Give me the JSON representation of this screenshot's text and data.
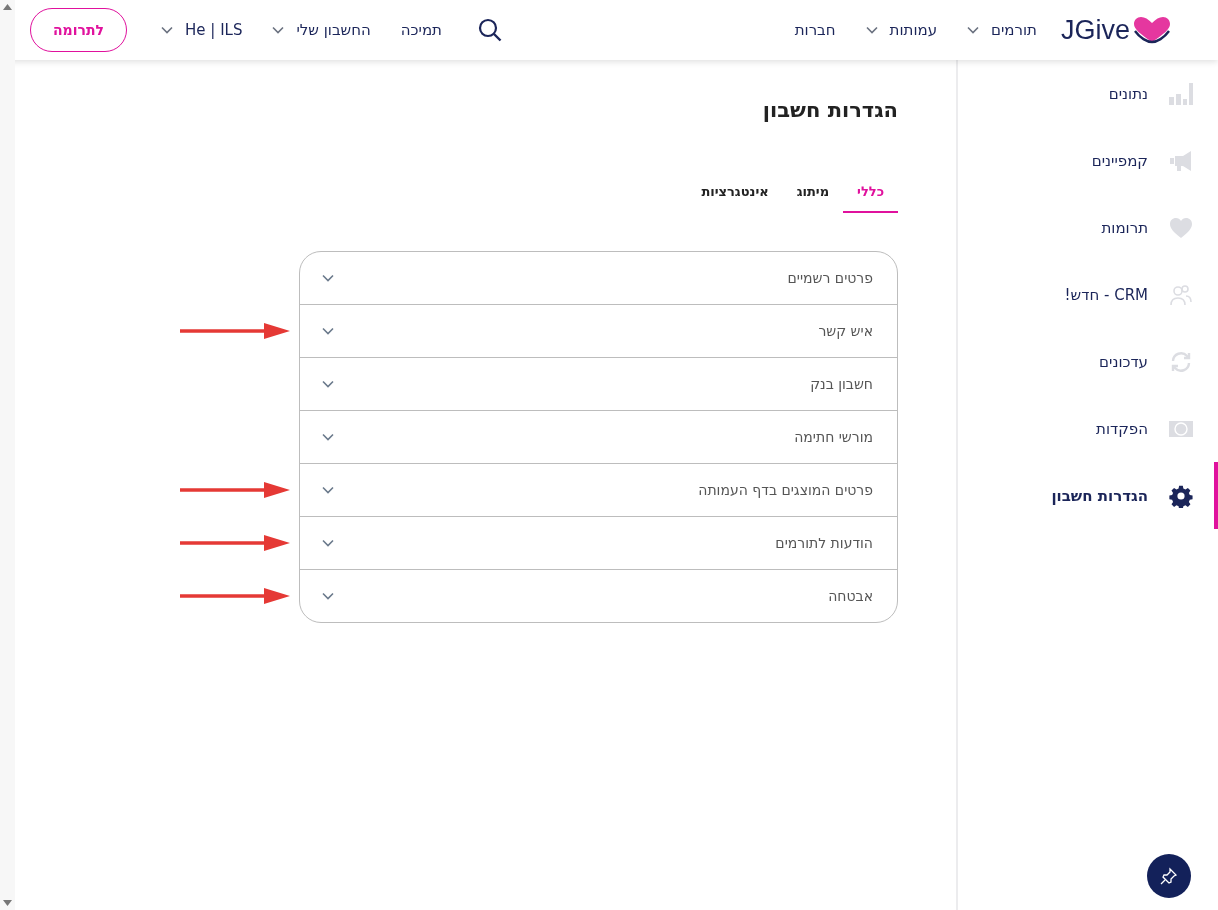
{
  "header": {
    "logo": "JGive",
    "nav": [
      {
        "label": "תורמים",
        "dropdown": true
      },
      {
        "label": "עמותות",
        "dropdown": true
      },
      {
        "label": "חברות",
        "dropdown": false
      }
    ],
    "user_nav": [
      {
        "label": "תמיכה",
        "dropdown": false
      },
      {
        "label": "החשבון שלי",
        "dropdown": true
      },
      {
        "label": "He | ILS",
        "dropdown": true
      }
    ],
    "donate_button": "לתרומה"
  },
  "sidebar": {
    "items": [
      {
        "label": "נתונים",
        "kind": "chart",
        "selected": false
      },
      {
        "label": "קמפיינים",
        "kind": "megaphone",
        "selected": false
      },
      {
        "label": "תרומות",
        "kind": "heart",
        "selected": false
      },
      {
        "label": "CRM - חדש!",
        "kind": "people",
        "selected": false
      },
      {
        "label": "עדכונים",
        "kind": "refresh",
        "selected": false
      },
      {
        "label": "הפקדות",
        "kind": "cash",
        "selected": false
      },
      {
        "label": "הגדרות חשבון",
        "kind": "gear",
        "selected": true
      }
    ]
  },
  "page": {
    "title": "הגדרות חשבון",
    "tabs": [
      {
        "label": "כללי",
        "selected": true
      },
      {
        "label": "מיתוג",
        "selected": false
      },
      {
        "label": "אינטגרציות",
        "selected": false
      }
    ],
    "sections": [
      {
        "label": "פרטים רשמיים",
        "expanded": false,
        "marked": false
      },
      {
        "label": "איש קשר",
        "expanded": false,
        "marked": true
      },
      {
        "label": "חשבון בנק",
        "expanded": false,
        "marked": false
      },
      {
        "label": "מורשי חתימה",
        "expanded": false,
        "marked": false
      },
      {
        "label": "פרטים המוצגים בדף העמותה",
        "expanded": false,
        "marked": true
      },
      {
        "label": "הודעות לתורמים",
        "expanded": false,
        "marked": true
      },
      {
        "label": "אבטחה",
        "expanded": false,
        "marked": true
      }
    ]
  }
}
